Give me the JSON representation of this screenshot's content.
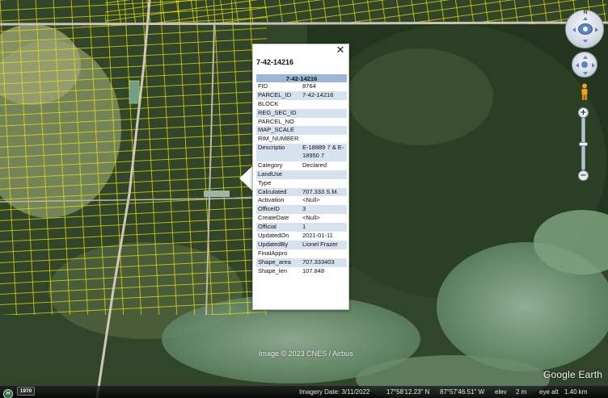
{
  "balloon": {
    "title": "7-42-14216",
    "table_header": "7-42-14216",
    "close_glyph": "✕",
    "rows": [
      {
        "key": "FID",
        "value": "8764"
      },
      {
        "key": "PARCEL_ID",
        "value": "7-42-14216"
      },
      {
        "key": "BLOCK",
        "value": ""
      },
      {
        "key": "REG_SEC_ID",
        "value": ""
      },
      {
        "key": "PARCEL_NO",
        "value": ""
      },
      {
        "key": "MAP_SCALE",
        "value": ""
      },
      {
        "key": "RIM_NUMBER",
        "value": ""
      },
      {
        "key": "Descriptio",
        "value": "E-18889 7 & E-18950 7"
      },
      {
        "key": "Category",
        "value": "Declared"
      },
      {
        "key": "LandUse",
        "value": ""
      },
      {
        "key": "Type",
        "value": ""
      },
      {
        "key": "Calculated",
        "value": "707.333 S.M."
      },
      {
        "key": "Activation",
        "value": "<Null>"
      },
      {
        "key": "OfficeID",
        "value": "3"
      },
      {
        "key": "CreateDate",
        "value": "<Null>"
      },
      {
        "key": "Official",
        "value": "1"
      },
      {
        "key": "UpdatedOn",
        "value": "2021-01-11"
      },
      {
        "key": "UpdatedBy",
        "value": "Lionel Frazer"
      },
      {
        "key": "FinalAppro",
        "value": ""
      },
      {
        "key": "Shape_area",
        "value": "707.333403"
      },
      {
        "key": "Shape_len",
        "value": "107.848"
      }
    ]
  },
  "navigation": {
    "north_label": "N",
    "zoom_in": "+",
    "zoom_out": "−",
    "icons": [
      "look-around-icon",
      "move-icon",
      "street-view-pegman-icon"
    ]
  },
  "overlay": {
    "copyright": "Image © 2023 CNES / Airbus",
    "brand": "Google Earth"
  },
  "statusbar": {
    "history_icon_label": "H",
    "year": "1970",
    "imagery_date": "Imagery Date: 3/11/2022",
    "latitude": "17°58'12.23\" N",
    "longitude": "87°57'46.51\" W",
    "elev_label": "elev",
    "elev_value": "2 m",
    "eye_alt_label": "eye alt",
    "eye_alt_value": "1.40 km"
  },
  "colors": {
    "parcel_lines": "#f2e600",
    "table_header_bg": "#9cb6d6",
    "table_alt_row_bg": "#d7e2ef"
  }
}
